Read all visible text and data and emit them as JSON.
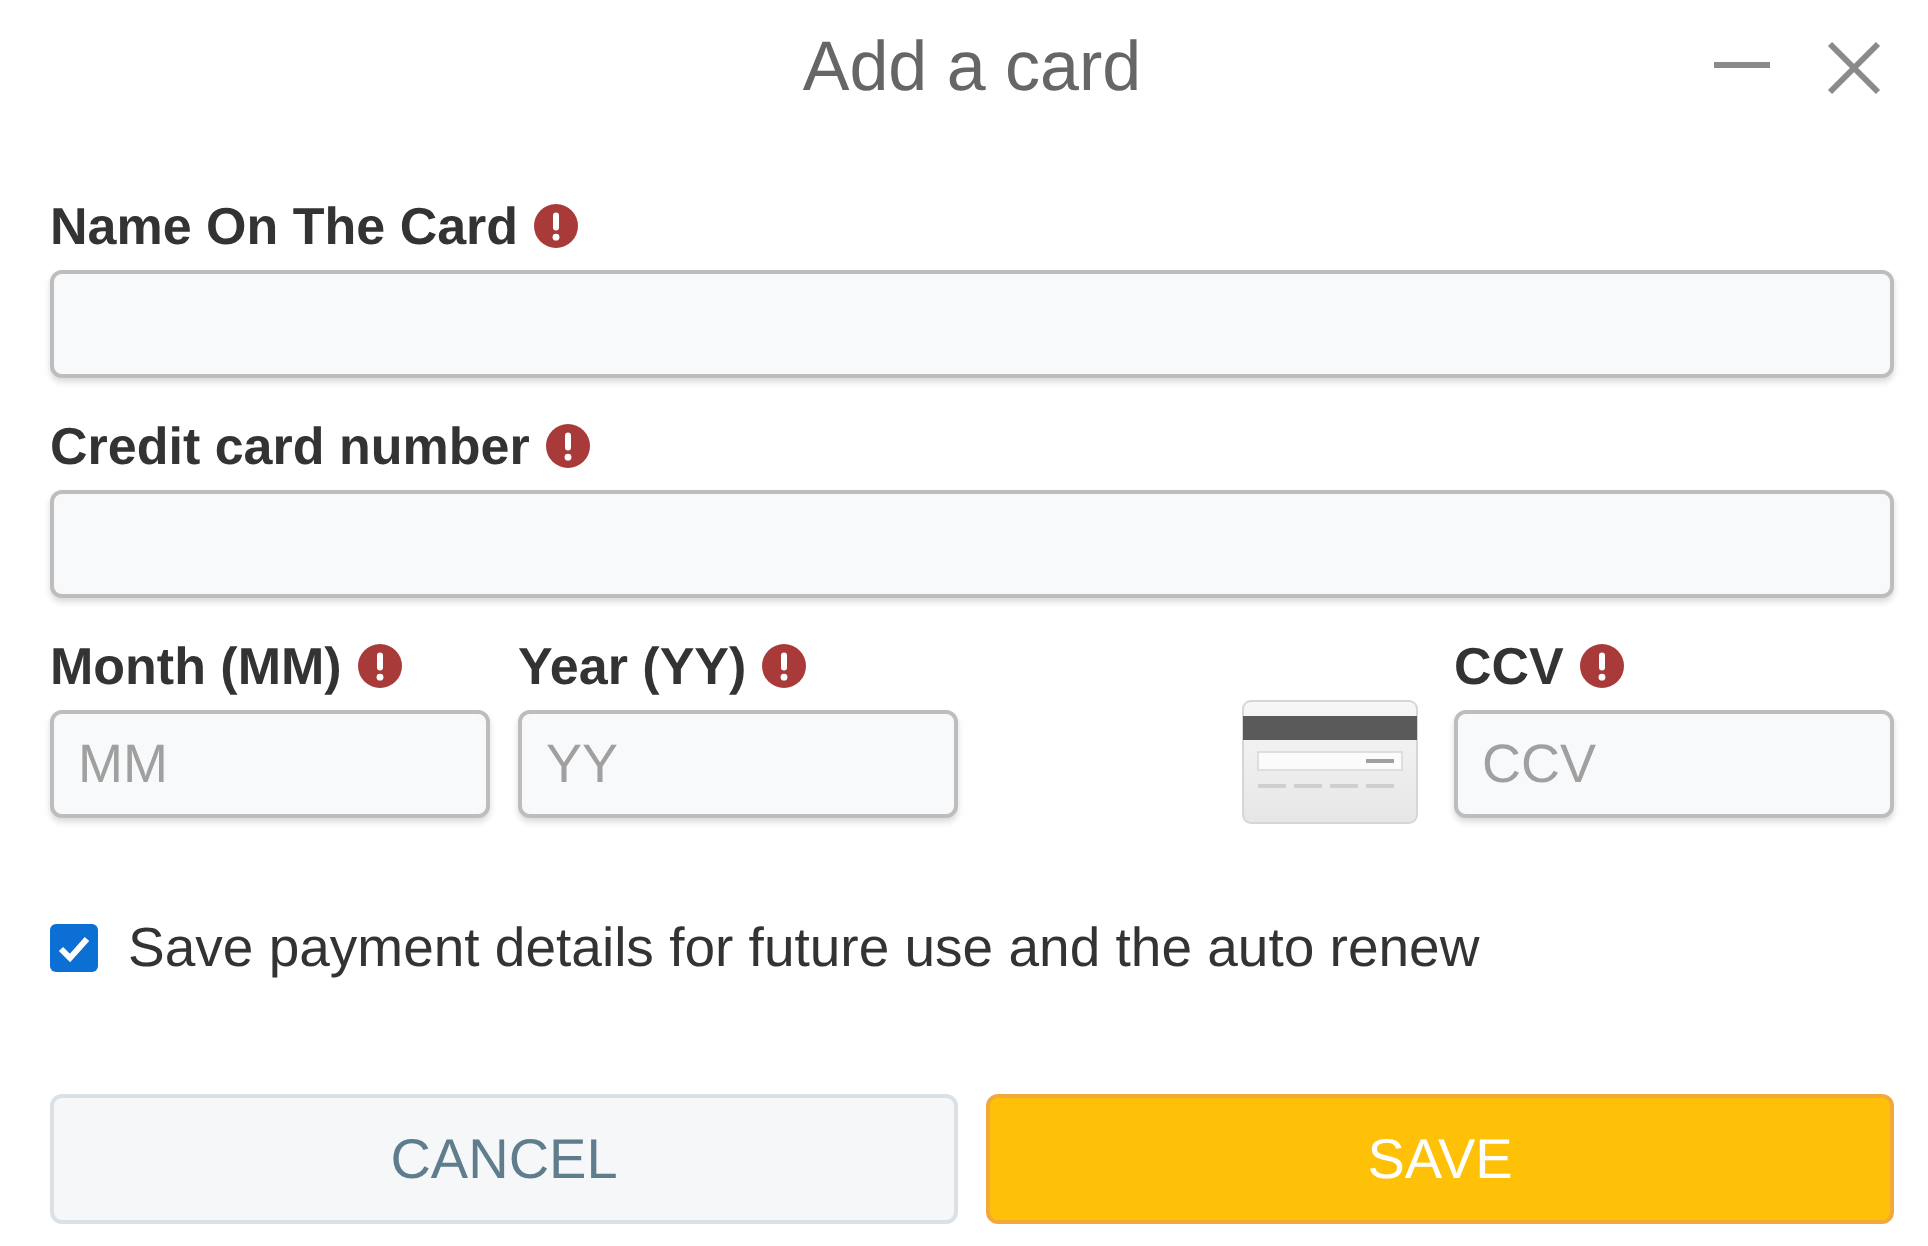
{
  "window": {
    "title": "Add a card"
  },
  "card_fields": [
    {
      "label": "Name On The Card",
      "error": true
    },
    {
      "label": "Credit card number",
      "error": true
    }
  ],
  "expiry_fields": [
    {
      "label": "Month (MM)",
      "error": true,
      "placeholder": "MM"
    },
    {
      "label": "Year (YY)",
      "error": true,
      "placeholder": "YY"
    }
  ],
  "ccv_field": {
    "label": "CCV",
    "error": true,
    "placeholder": "CCV"
  },
  "save_details": {
    "label": "Save payment details for future use and the auto renew",
    "checked": true
  },
  "buttons": [
    {
      "label": "CANCEL",
      "kind": "secondary"
    },
    {
      "label": "SAVE",
      "kind": "primary"
    }
  ]
}
